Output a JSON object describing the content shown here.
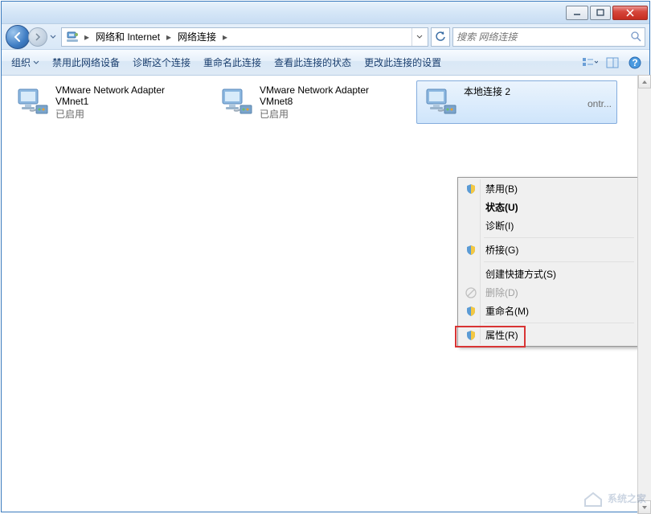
{
  "titlebar": {
    "min": "–",
    "max": "□",
    "close": "×"
  },
  "breadcrumb": {
    "seg1": "网络和 Internet",
    "seg2": "网络连接"
  },
  "search": {
    "placeholder": "搜索 网络连接"
  },
  "toolbar": {
    "organize": "组织",
    "disable": "禁用此网络设备",
    "diagnose": "诊断这个连接",
    "rename": "重命名此连接",
    "status": "查看此连接的状态",
    "change": "更改此连接的设置"
  },
  "connections": [
    {
      "title": "VMware Network Adapter",
      "line2": "VMnet1",
      "status": "已启用"
    },
    {
      "title": "VMware Network Adapter",
      "line2": "VMnet8",
      "status": "已启用"
    },
    {
      "title": "本地连接 2",
      "line2": "",
      "status": "ontr..."
    }
  ],
  "ctx": {
    "disable": "禁用(B)",
    "status": "状态(U)",
    "diagnose": "诊断(I)",
    "bridge": "桥接(G)",
    "shortcut": "创建快捷方式(S)",
    "delete": "删除(D)",
    "rename": "重命名(M)",
    "properties": "属性(R)"
  },
  "watermark": "系统之家"
}
